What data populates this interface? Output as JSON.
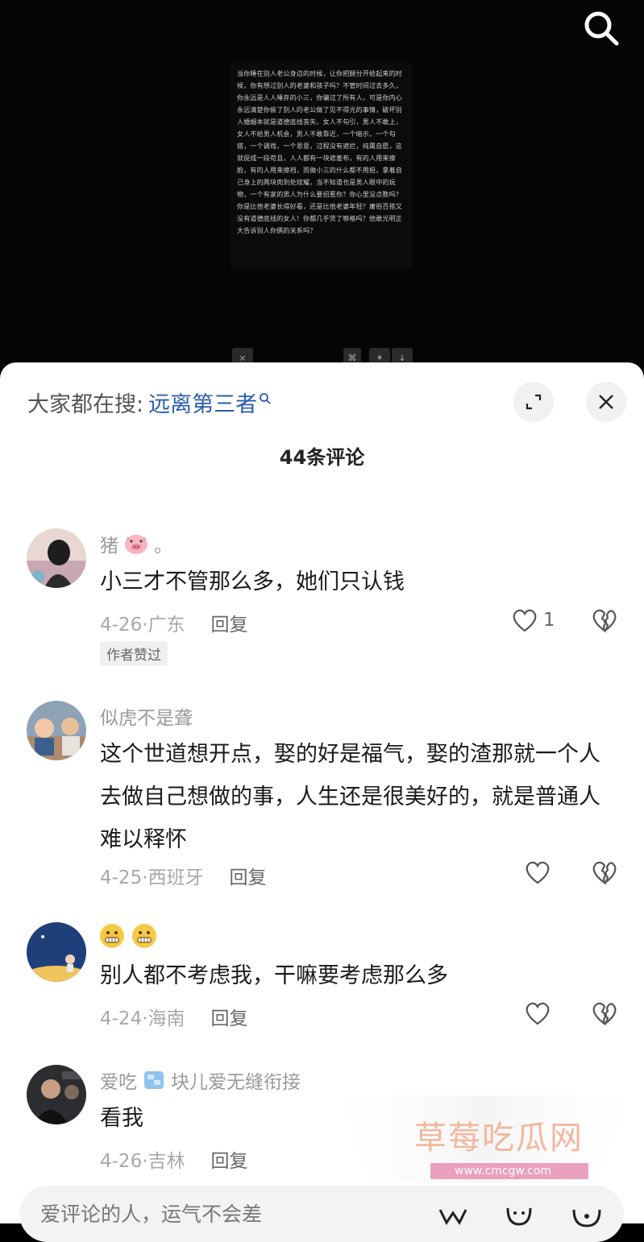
{
  "video": {
    "paragraph": "当你睡在别人老公身边的时候，让你把腿分开给起来的时候，你有想过别人的老婆和孩子吗？不管时间过去多久，你永远是人人唾弃的小三，你骗过了所有人，可是你内心永远清楚你偷了别人的老公做了见不得光的事情，破坏别人婚姻本就是道德底线丧失，女人不勾引，男人不敢上，女人不给男人机会，男人不敢靠近，一个暗示，一个勾搭，一个调戏，一个恩意，过程没有遮拦，纯属自愿，这就促成一段苟且，人人都有一块遮羞布，有的人用来擦脸，有的人用来擦裆，而做小三的什么都不用担，拿着自己身上的两块肉到处炫耀，当不知道也是男人眼中的玩物，一个有家的男人为什么要招惹你？你心里没点数吗？你是比他老婆长得好看，还是比他老婆年轻？庸俗百搭又没有道德底线的女人！你都几乎货了够格吗？他敢光明正大告诉别人你俩的关系吗？",
    "controls": [
      "×",
      "⌘",
      "⏸",
      "↓"
    ]
  },
  "header": {
    "prefix": "大家都在搜:",
    "hot_search": "远离第三者",
    "comment_count": "44条评论"
  },
  "comments": [
    {
      "name": "猪",
      "name_suffix": "。",
      "text": "小三才不管那么多，她们只认钱",
      "date": "4-26·广东",
      "reply": "回复",
      "likes": "1",
      "badge": "作者赞过"
    },
    {
      "name": "似虎不是聋",
      "text": "这个世道想开点，娶的好是福气，娶的渣那就一个人去做自己想做的事，人生还是很美好的，就是普通人难以释怀",
      "date": "4-25·西班牙",
      "reply": "回复"
    },
    {
      "name": "",
      "text": "别人都不考虑我，干嘛要考虑那么多",
      "date": "4-24·海南",
      "reply": "回复"
    },
    {
      "name": "爱吃",
      "name_suffix": "块儿爱无缝衔接",
      "text": "看我",
      "date": "4-26·吉林",
      "reply": "回复"
    }
  ],
  "input": {
    "placeholder": "爱评论的人，运气不会差"
  },
  "watermark": {
    "title": "草莓吃瓜网",
    "url": "www.cmcgw.com"
  },
  "colors": {
    "accent_link": "#2a5db0",
    "sheet_bg": "#ffffff",
    "video_bg": "#050505",
    "watermark": "#f3b79e"
  }
}
